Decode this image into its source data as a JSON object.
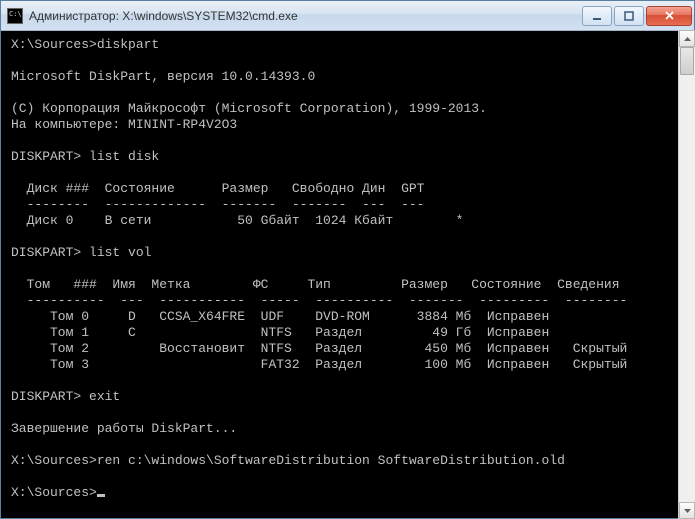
{
  "window": {
    "title": "Администратор: X:\\windows\\SYSTEM32\\cmd.exe"
  },
  "lines": {
    "l01": "X:\\Sources>diskpart",
    "l02": "",
    "l03": "Microsoft DiskPart, версия 10.0.14393.0",
    "l04": "",
    "l05": "(C) Корпорация Майкрософт (Microsoft Corporation), 1999-2013.",
    "l06": "На компьютере: MININT-RP4V2O3",
    "l07": "",
    "l08": "DISKPART> list disk",
    "l09": "",
    "l10": "  Диск ###  Состояние      Размер   Свободно Дин  GPT",
    "l11": "  --------  -------------  -------  -------  ---  ---",
    "l12": "  Диск 0    В сети           50 Gбайт  1024 Кбайт        *",
    "l13": "",
    "l14": "DISKPART> list vol",
    "l15": "",
    "l16": "  Том   ###  Имя  Метка        ФС     Тип         Размер   Состояние  Сведения",
    "l17": "  ----------  ---  -----------  -----  ----------  -------  ---------  --------",
    "l18": "     Том 0     D   CCSA_X64FRE  UDF    DVD-ROM      3884 Мб  Исправен",
    "l19": "     Том 1     C                NTFS   Раздел         49 Гб  Исправен",
    "l20": "     Том 2         Восстановит  NTFS   Раздел        450 Мб  Исправен   Скрытый",
    "l21": "     Том 3                      FAT32  Раздел        100 Мб  Исправен   Скрытый",
    "l22": "",
    "l23": "DISKPART> exit",
    "l24": "",
    "l25": "Завершение работы DiskPart...",
    "l26": "",
    "l27": "X:\\Sources>ren c:\\windows\\SoftwareDistribution SoftwareDistribution.old",
    "l28": "",
    "l29": "X:\\Sources>"
  },
  "chart_data": {
    "type": "table",
    "disks": {
      "columns": [
        "Диск ###",
        "Состояние",
        "Размер",
        "Свободно",
        "Дин",
        "GPT"
      ],
      "rows": [
        [
          "Диск 0",
          "В сети",
          "50 Gбайт",
          "1024 Кбайт",
          "",
          "*"
        ]
      ]
    },
    "volumes": {
      "columns": [
        "Том",
        "###",
        "Имя",
        "Метка",
        "ФС",
        "Тип",
        "Размер",
        "Состояние",
        "Сведения"
      ],
      "rows": [
        [
          "Том 0",
          "",
          "D",
          "CCSA_X64FRE",
          "UDF",
          "DVD-ROM",
          "3884 Мб",
          "Исправен",
          ""
        ],
        [
          "Том 1",
          "",
          "C",
          "",
          "NTFS",
          "Раздел",
          "49 Гб",
          "Исправен",
          ""
        ],
        [
          "Том 2",
          "",
          "",
          "Восстановит",
          "NTFS",
          "Раздел",
          "450 Мб",
          "Исправен",
          "Скрытый"
        ],
        [
          "Том 3",
          "",
          "",
          "",
          "FAT32",
          "Раздел",
          "100 Мб",
          "Исправен",
          "Скрытый"
        ]
      ]
    }
  }
}
